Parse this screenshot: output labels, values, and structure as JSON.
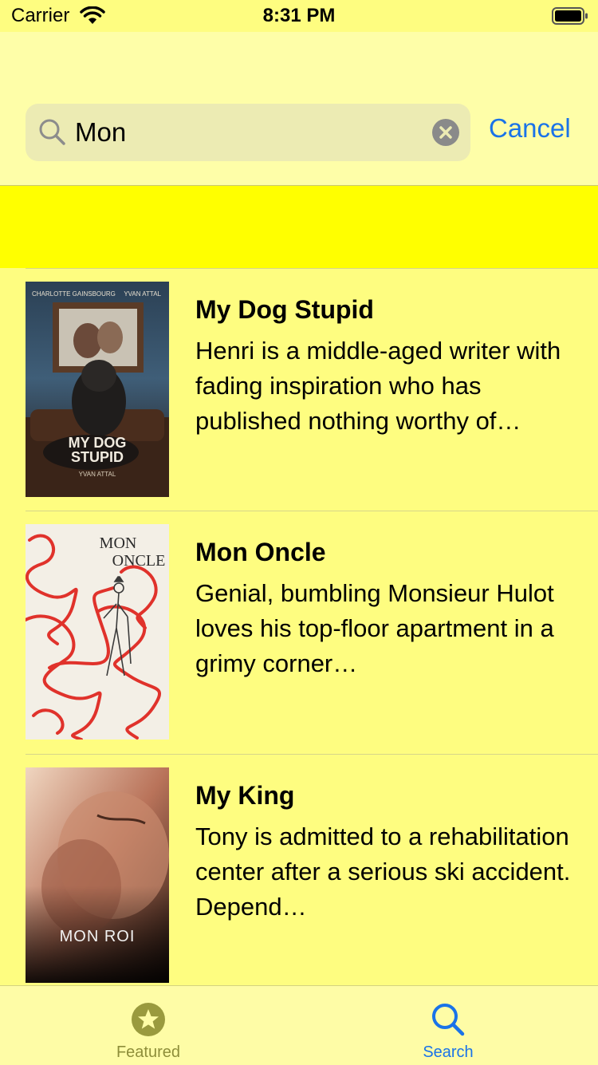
{
  "status_bar": {
    "carrier": "Carrier",
    "time": "8:31 PM"
  },
  "search": {
    "query": "Mon",
    "cancel_label": "Cancel"
  },
  "colors": {
    "accent": "#1a73e8",
    "background": "#fefd80",
    "banner": "#ffff00",
    "inactive_tab": "#8e8e3a"
  },
  "results": [
    {
      "title": "My Dog Stupid",
      "description": "Henri is a middle-aged writer with fading inspiration who has published nothing worthy of…",
      "poster": {
        "top_left": "CHARLOTTE GAINSBOURG",
        "top_right": "YVAN ATTAL",
        "title_line1": "MY DOG",
        "title_line2": "STUPID",
        "credit": "YVAN ATTAL"
      }
    },
    {
      "title": "Mon Oncle",
      "description": "Genial, bumbling Monsieur Hulot loves his top-floor apartment in a grimy corner…",
      "poster": {
        "title_line1": "MON",
        "title_line2": "ONCLE"
      }
    },
    {
      "title": "My King",
      "description": "Tony is admitted to a rehabilitation center after a serious ski accident. Depend…",
      "poster": {
        "title_line1": "MON ROI"
      }
    }
  ],
  "tabbar": {
    "tabs": [
      {
        "label": "Featured",
        "icon": "star-circle-icon",
        "selected": false
      },
      {
        "label": "Search",
        "icon": "search-icon",
        "selected": true
      }
    ]
  }
}
